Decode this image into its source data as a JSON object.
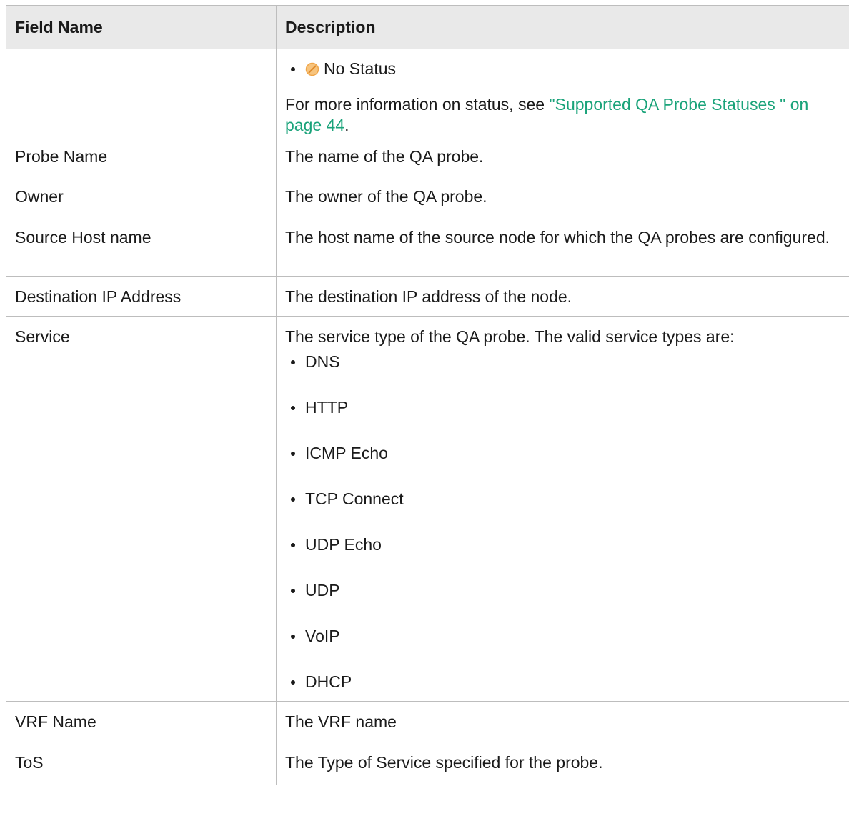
{
  "header": {
    "col1": "Field Name",
    "col2": "Description"
  },
  "status_row": {
    "bullet_label": "No Status",
    "icon": "no-status-icon",
    "info_prefix": "For more information on status, see ",
    "info_link": "\"Supported QA Probe Statuses \" on page 44",
    "info_suffix": "."
  },
  "rows": [
    {
      "field": "Probe Name",
      "desc": "The name of the QA probe."
    },
    {
      "field": "Owner",
      "desc": "The owner of the QA probe."
    },
    {
      "field": "Source Host name",
      "desc": "The host name of the source node for which the QA probes are configured."
    },
    {
      "field": "Destination IP Address",
      "desc": "The destination IP address of the node."
    }
  ],
  "service_row": {
    "field": "Service",
    "intro": "The service type of the QA probe. The valid service types are:",
    "types": [
      "DNS",
      "HTTP",
      "ICMP Echo",
      "TCP Connect",
      "UDP Echo",
      "UDP",
      "VoIP",
      "DHCP"
    ]
  },
  "tail_rows": [
    {
      "field": "VRF Name",
      "desc": "The VRF name"
    },
    {
      "field": "ToS",
      "desc": "The Type of Service specified for the probe."
    }
  ],
  "colors": {
    "header_bg": "#e9e9e9",
    "border": "#bdbdbd",
    "link": "#1aa37a",
    "status_icon": "#f0a64a"
  }
}
